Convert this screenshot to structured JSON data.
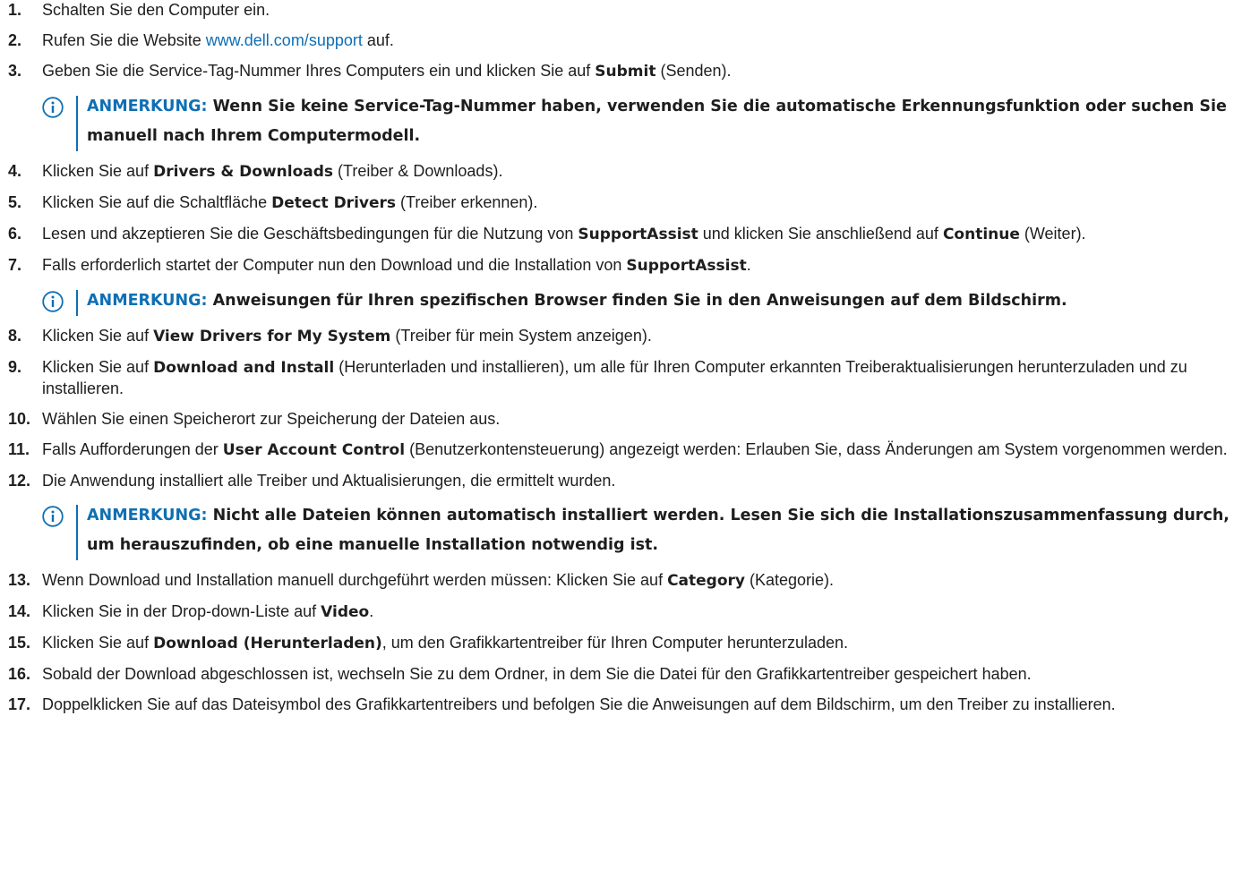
{
  "steps": [
    {
      "num": "1.",
      "parts": [
        {
          "t": "Schalten Sie den Computer ein."
        }
      ]
    },
    {
      "num": "2.",
      "parts": [
        {
          "t": "Rufen Sie die Website "
        },
        {
          "t": "www.dell.com/support",
          "link": true
        },
        {
          "t": " auf."
        }
      ]
    },
    {
      "num": "3.",
      "parts": [
        {
          "t": "Geben Sie die Service-Tag-Nummer Ihres Computers ein und klicken Sie auf "
        },
        {
          "t": "Submit",
          "b": true
        },
        {
          "t": " (Senden)."
        }
      ]
    },
    {
      "note": true,
      "label": "ANMERKUNG:",
      "text": "Wenn Sie keine Service-Tag-Nummer haben, verwenden Sie die automatische Erkennungsfunktion oder suchen Sie manuell nach Ihrem Computermodell."
    },
    {
      "num": "4.",
      "parts": [
        {
          "t": "Klicken Sie auf "
        },
        {
          "t": "Drivers & Downloads",
          "b": true
        },
        {
          "t": " (Treiber & Downloads)."
        }
      ]
    },
    {
      "num": "5.",
      "parts": [
        {
          "t": "Klicken Sie auf die Schaltfläche "
        },
        {
          "t": "Detect Drivers",
          "b": true
        },
        {
          "t": " (Treiber erkennen)."
        }
      ]
    },
    {
      "num": "6.",
      "parts": [
        {
          "t": "Lesen und akzeptieren Sie die Geschäftsbedingungen für die Nutzung von "
        },
        {
          "t": "SupportAssist",
          "b": true
        },
        {
          "t": " und klicken Sie anschließend auf "
        },
        {
          "t": "Continue",
          "b": true
        },
        {
          "t": " (Weiter)."
        }
      ]
    },
    {
      "num": "7.",
      "parts": [
        {
          "t": "Falls erforderlich startet der Computer nun den Download und die Installation von "
        },
        {
          "t": "SupportAssist",
          "b": true
        },
        {
          "t": "."
        }
      ]
    },
    {
      "note": true,
      "label": "ANMERKUNG:",
      "text": "Anweisungen für Ihren spezifischen Browser finden Sie in den Anweisungen auf dem Bildschirm."
    },
    {
      "num": "8.",
      "parts": [
        {
          "t": "Klicken Sie auf "
        },
        {
          "t": "View Drivers for My System",
          "b": true
        },
        {
          "t": " (Treiber für mein System anzeigen)."
        }
      ]
    },
    {
      "num": "9.",
      "parts": [
        {
          "t": "Klicken Sie auf "
        },
        {
          "t": "Download and Install",
          "b": true
        },
        {
          "t": " (Herunterladen und installieren), um alle für Ihren Computer erkannten Treiberaktualisierungen herunterzuladen und zu installieren."
        }
      ]
    },
    {
      "num": "10.",
      "parts": [
        {
          "t": "Wählen Sie einen Speicherort zur Speicherung der Dateien aus."
        }
      ]
    },
    {
      "num": "11.",
      "parts": [
        {
          "t": "Falls Aufforderungen der "
        },
        {
          "t": "User Account Control",
          "b": true
        },
        {
          "t": " (Benutzerkontensteuerung) angezeigt werden: Erlauben Sie, dass Änderungen am System vorgenommen werden."
        }
      ]
    },
    {
      "num": "12.",
      "parts": [
        {
          "t": "Die Anwendung installiert alle Treiber und Aktualisierungen, die ermittelt wurden."
        }
      ]
    },
    {
      "note": true,
      "label": "ANMERKUNG:",
      "text": "Nicht alle Dateien können automatisch installiert werden. Lesen Sie sich die Installationszusammenfassung durch, um herauszufinden, ob eine manuelle Installation notwendig ist."
    },
    {
      "num": "13.",
      "parts": [
        {
          "t": "Wenn Download und Installation manuell durchgeführt werden müssen: Klicken Sie auf "
        },
        {
          "t": "Category",
          "b": true
        },
        {
          "t": " (Kategorie)."
        }
      ]
    },
    {
      "num": "14.",
      "parts": [
        {
          "t": "Klicken Sie in der Drop-down-Liste auf "
        },
        {
          "t": "Video",
          "b": true
        },
        {
          "t": "."
        }
      ]
    },
    {
      "num": "15.",
      "parts": [
        {
          "t": "Klicken Sie auf "
        },
        {
          "t": "Download (Herunterladen)",
          "b": true
        },
        {
          "t": ", um den Grafikkartentreiber für Ihren Computer herunterzuladen."
        }
      ]
    },
    {
      "num": "16.",
      "parts": [
        {
          "t": "Sobald der Download abgeschlossen ist, wechseln Sie zu dem Ordner, in dem Sie die Datei für den Grafikkartentreiber gespeichert haben."
        }
      ]
    },
    {
      "num": "17.",
      "parts": [
        {
          "t": "Doppelklicken Sie auf das Dateisymbol des Grafikkartentreibers und befolgen Sie die Anweisungen auf dem Bildschirm, um den Treiber zu installieren."
        }
      ]
    }
  ],
  "colors": {
    "accent": "#0e6fb4",
    "text": "#1e1e1e"
  },
  "icons": {
    "note": "info-circle-icon"
  }
}
